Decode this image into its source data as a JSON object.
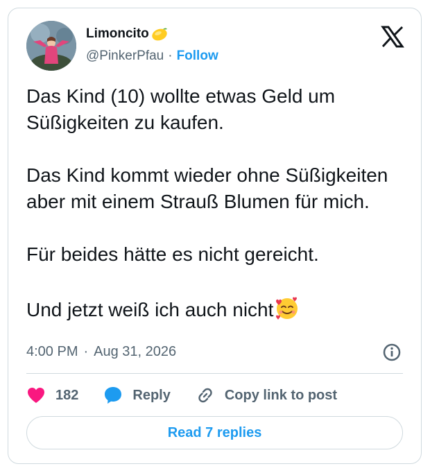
{
  "author": {
    "display_name": "Limoncito",
    "handle": "@PinkerPfau",
    "separator": "·",
    "follow_label": "Follow"
  },
  "tweet": {
    "paragraphs": [
      "Das Kind (10) wollte etwas Geld um Süßigkeiten zu kaufen.",
      "Das Kind kommt wieder ohne Süßigkeiten aber mit einem Strauß Blumen für mich.",
      "Für beides hätte es nicht gereicht.",
      "Und jetzt weiß ich auch nicht"
    ],
    "time": "4:00 PM",
    "separator": "·",
    "date": "Aug 31, 2026"
  },
  "actions": {
    "likes": "182",
    "reply_label": "Reply",
    "copy_link_label": "Copy link to post"
  },
  "read_replies_label": "Read 7 replies",
  "icons": {
    "lemon": "lemon-emoji",
    "smile": "smiling-face-with-hearts-emoji",
    "x_logo": "x-logo-icon",
    "info": "info-icon",
    "heart": "heart-icon",
    "reply": "reply-bubble-icon",
    "link": "link-icon"
  },
  "colors": {
    "accent": "#1d9bf0",
    "heart": "#f91880",
    "text": "#0f1419",
    "muted": "#536471",
    "border": "#cfd9de"
  }
}
